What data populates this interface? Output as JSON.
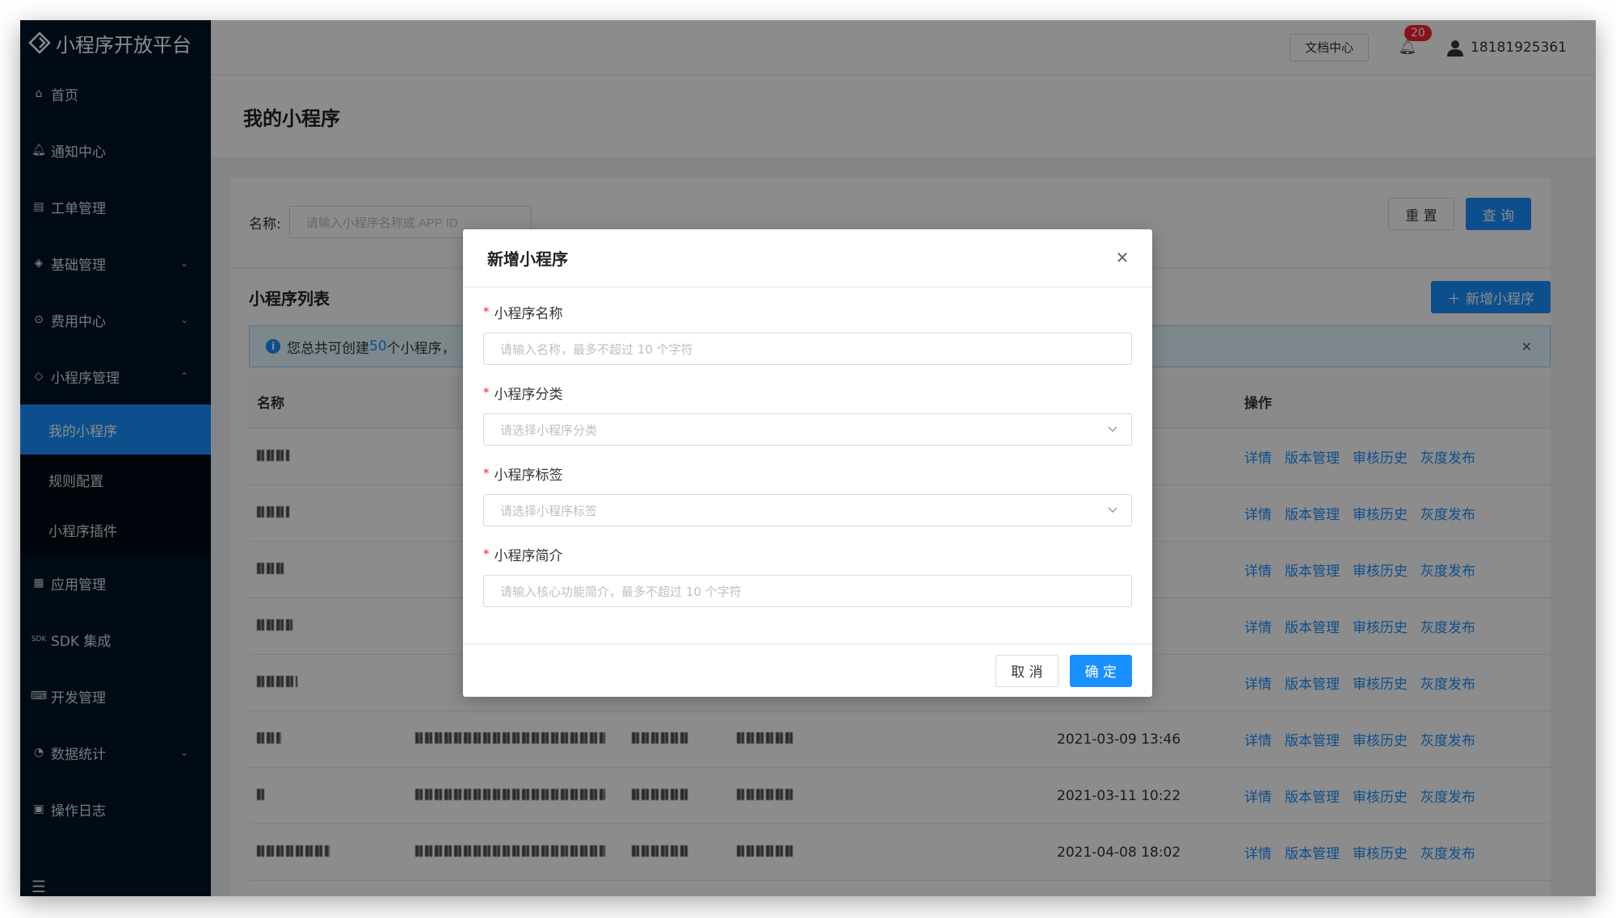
{
  "app": {
    "title": "小程序开放平台"
  },
  "sidebar": {
    "items": [
      {
        "label": "首页",
        "icon": "home-icon"
      },
      {
        "label": "通知中心",
        "icon": "bell-icon"
      },
      {
        "label": "工单管理",
        "icon": "ticket-icon"
      },
      {
        "label": "基础管理",
        "icon": "layers-icon",
        "expandable": true
      },
      {
        "label": "费用中心",
        "icon": "coin-icon",
        "expandable": true
      },
      {
        "label": "小程序管理",
        "icon": "diamond-icon",
        "expanded": true
      },
      {
        "label": "应用管理",
        "icon": "grid-icon"
      },
      {
        "label": "SDK 集成",
        "icon": "sdk-icon"
      },
      {
        "label": "开发管理",
        "icon": "code-icon"
      },
      {
        "label": "数据统计",
        "icon": "chart-icon",
        "expandable": true
      },
      {
        "label": "操作日志",
        "icon": "log-icon"
      }
    ],
    "submenu": [
      {
        "label": "我的小程序",
        "active": true
      },
      {
        "label": "规则配置"
      },
      {
        "label": "小程序插件"
      }
    ]
  },
  "header": {
    "doc_center": "文档中心",
    "notification_count": "20",
    "username": "18181925361"
  },
  "page": {
    "title": "我的小程序"
  },
  "search": {
    "label": "名称:",
    "placeholder": "请输入小程序名称或 APP ID",
    "reset": "重 置",
    "query": "查 询"
  },
  "list": {
    "title": "小程序列表",
    "add_button": "新增小程序",
    "alert_prefix": "您总共可创建",
    "alert_count": "50",
    "alert_suffix": "个小程序，",
    "columns": {
      "name": "名称",
      "ops": "操作"
    },
    "ops_labels": [
      "详情",
      "版本管理",
      "审核历史",
      "灰度发布"
    ],
    "rows": [
      {
        "time": ""
      },
      {
        "time": ""
      },
      {
        "time": ""
      },
      {
        "time": ""
      },
      {
        "time": ""
      },
      {
        "time": "2021-03-09 13:46"
      },
      {
        "time": "2021-03-11 10:22"
      },
      {
        "time": "2021-04-08 18:02"
      }
    ]
  },
  "modal": {
    "title": "新增小程序",
    "fields": [
      {
        "label": "小程序名称",
        "placeholder": "请输入名称，最多不超过 10 个字符",
        "type": "input"
      },
      {
        "label": "小程序分类",
        "placeholder": "请选择小程序分类",
        "type": "select"
      },
      {
        "label": "小程序标签",
        "placeholder": "请选择小程序标签",
        "type": "select"
      },
      {
        "label": "小程序简介",
        "placeholder": "请输入核心功能简介，最多不超过 10 个字符",
        "type": "input"
      }
    ],
    "cancel": "取 消",
    "confirm": "确 定"
  },
  "colors": {
    "primary": "#1890ff",
    "sidebar": "#001529",
    "danger": "#f5222d"
  }
}
